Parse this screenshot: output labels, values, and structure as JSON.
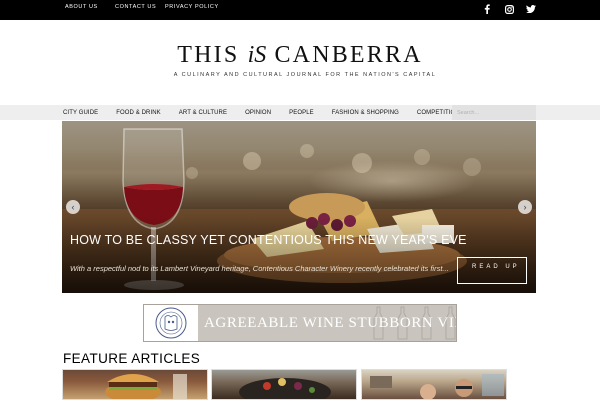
{
  "topbar": {
    "links": [
      "ABOUT US",
      "CONTACT US",
      "PRIVACY POLICY"
    ],
    "social_icons": [
      "facebook-icon",
      "instagram-icon",
      "twitter-icon"
    ]
  },
  "masthead": {
    "title_this": "THIS",
    "title_is": "iS",
    "title_canberra": "CANBERRA",
    "tagline": "A CULINARY AND CULTURAL JOURNAL FOR THE NATION'S CAPITAL"
  },
  "nav": {
    "items": [
      "CITY GUIDE",
      "FOOD & DRINK",
      "ART & CULTURE",
      "OPINION",
      "PEOPLE",
      "FASHION & SHOPPING",
      "COMPETITIONS"
    ],
    "search_placeholder": "Search..."
  },
  "hero": {
    "title": "HOW TO BE CLASSY YET CONTENTIOUS THIS NEW YEAR'S EVE",
    "excerpt": "With a respectful nod to its Lambert Vineyard heritage, Contentious Character Winery recently celebrated its first...",
    "button": "READ UP",
    "prev_icon": "‹",
    "next_icon": "›"
  },
  "banner": {
    "text": "AGREEABLE WINE STUBBORN VINE"
  },
  "features": {
    "heading": "FEATURE ARTICLES"
  },
  "colors": {
    "topbar": "#000000",
    "nav_bg": "#eeeeee",
    "banner_bg": "#c9c4be"
  }
}
